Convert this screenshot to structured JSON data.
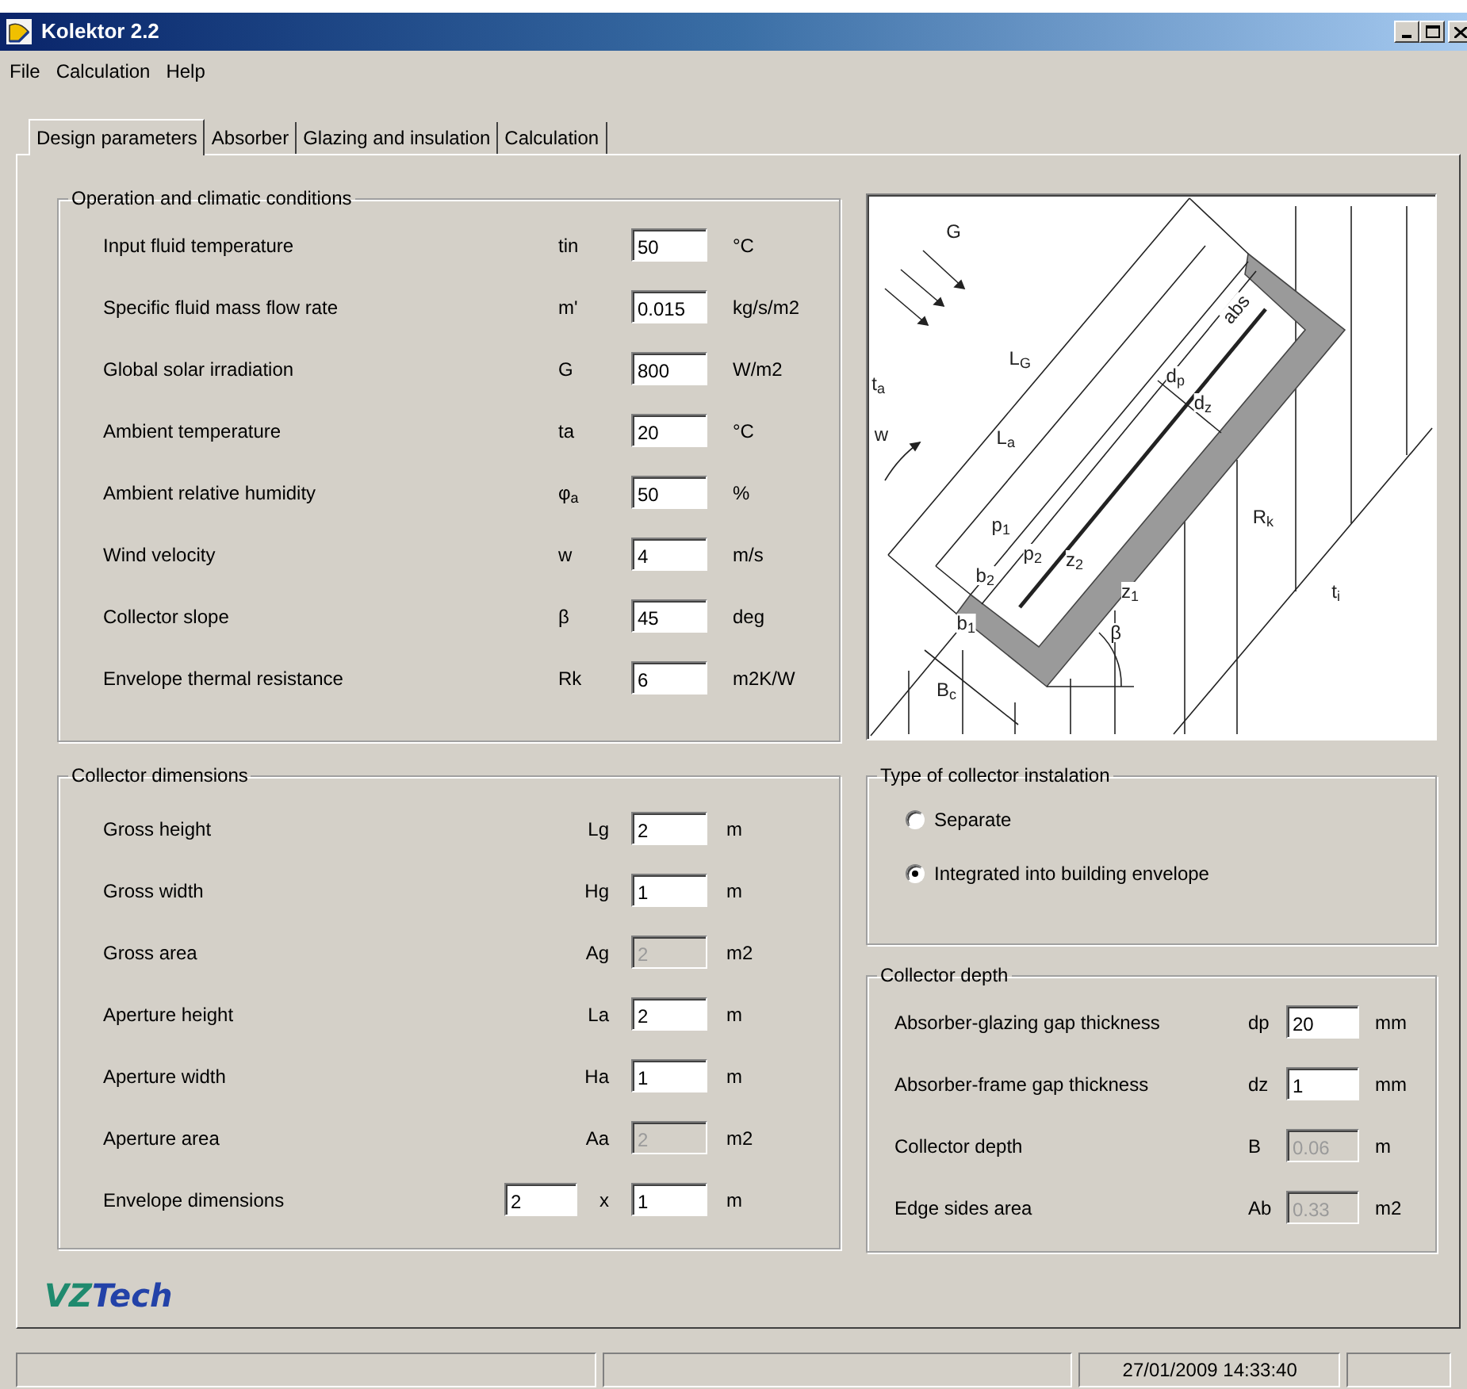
{
  "window": {
    "title": "Kolektor 2.2"
  },
  "menu": [
    "File",
    "Calculation",
    "Help"
  ],
  "tabs": [
    {
      "label": "Design parameters",
      "selected": true
    },
    {
      "label": "Absorber",
      "selected": false
    },
    {
      "label": "Glazing and insulation",
      "selected": false
    },
    {
      "label": "Calculation",
      "selected": false
    }
  ],
  "operation": {
    "title": "Operation and climatic conditions",
    "rows": [
      {
        "label": "Input fluid temperature",
        "symbol": "tin",
        "value": "50",
        "unit": "°C"
      },
      {
        "label": "Specific fluid mass flow rate",
        "symbol": "m'",
        "value": "0.015",
        "unit": "kg/s/m2"
      },
      {
        "label": "Global solar irradiation",
        "symbol": "G",
        "value": "800",
        "unit": "W/m2"
      },
      {
        "label": "Ambient temperature",
        "symbol": "ta",
        "value": "20",
        "unit": "°C"
      },
      {
        "label": "Ambient relative humidity",
        "symbol": "φ$_{a}$",
        "value": "50",
        "unit": "%"
      },
      {
        "label": "Wind velocity",
        "symbol": "w",
        "value": "4",
        "unit": "m/s"
      },
      {
        "label": "Collector slope",
        "symbol": "β",
        "value": "45",
        "unit": "deg"
      },
      {
        "label": "Envelope thermal resistance",
        "symbol": "Rk",
        "value": "6",
        "unit": "m2K/W"
      }
    ]
  },
  "diagram": {
    "labels": [
      "G",
      "L$_{G}$",
      "t$_{a}$",
      "w",
      "L$_{a}$",
      "d$_{p}$",
      "d$_{z}$",
      "abs",
      "p$_{1}$",
      "p$_{2}$",
      "z$_{2}$",
      "b$_{2}$",
      "z$_{1}$",
      "R$_{k}$",
      "t$_{i}$",
      "b$_{1}$",
      "β",
      "B$_{c}$"
    ]
  },
  "dimensions": {
    "title": "Collector dimensions",
    "rows": [
      {
        "kind": "single",
        "label": "Gross height",
        "symbol": "Lg",
        "value": "2",
        "unit": "m",
        "disabled": false
      },
      {
        "kind": "single",
        "label": "Gross width",
        "symbol": "Hg",
        "value": "1",
        "unit": "m",
        "disabled": false
      },
      {
        "kind": "single",
        "label": "Gross area",
        "symbol": "Ag",
        "value": "2",
        "unit": "m2",
        "disabled": true
      },
      {
        "kind": "single",
        "label": "Aperture height",
        "symbol": "La",
        "value": "2",
        "unit": "m",
        "disabled": false
      },
      {
        "kind": "single",
        "label": "Aperture width",
        "symbol": "Ha",
        "value": "1",
        "unit": "m",
        "disabled": false
      },
      {
        "kind": "single",
        "label": "Aperture area",
        "symbol": "Aa",
        "value": "2",
        "unit": "m2",
        "disabled": true
      },
      {
        "kind": "pair",
        "label": "Envelope dimensions",
        "value": "2",
        "separator": "x",
        "value2": "1",
        "unit": "m",
        "disabled": false
      }
    ]
  },
  "installation": {
    "title": "Type of collector instalation",
    "options": [
      {
        "label": "Separate",
        "selected": false
      },
      {
        "label": "Integrated into building envelope",
        "selected": true
      }
    ]
  },
  "depth": {
    "title": "Collector depth",
    "rows": [
      {
        "label": "Absorber-glazing gap thickness",
        "symbol": "dp",
        "value": "20",
        "unit": "mm",
        "disabled": false
      },
      {
        "label": "Absorber-frame gap thickness",
        "symbol": "dz",
        "value": "1",
        "unit": "mm",
        "disabled": false
      },
      {
        "label": "Collector depth",
        "symbol": "B",
        "value": "0.06",
        "unit": "m",
        "disabled": true
      },
      {
        "label": "Edge sides area",
        "symbol": "Ab",
        "value": "0.33",
        "unit": "m2",
        "disabled": true
      }
    ]
  },
  "logo": {
    "parts": [
      {
        "text": "VZ",
        "color": "#1f8a6e"
      },
      {
        "text": "Tech",
        "color": "#2342a8"
      }
    ]
  },
  "status_bar": {
    "datetime": "27/01/2009 14:33:40"
  }
}
